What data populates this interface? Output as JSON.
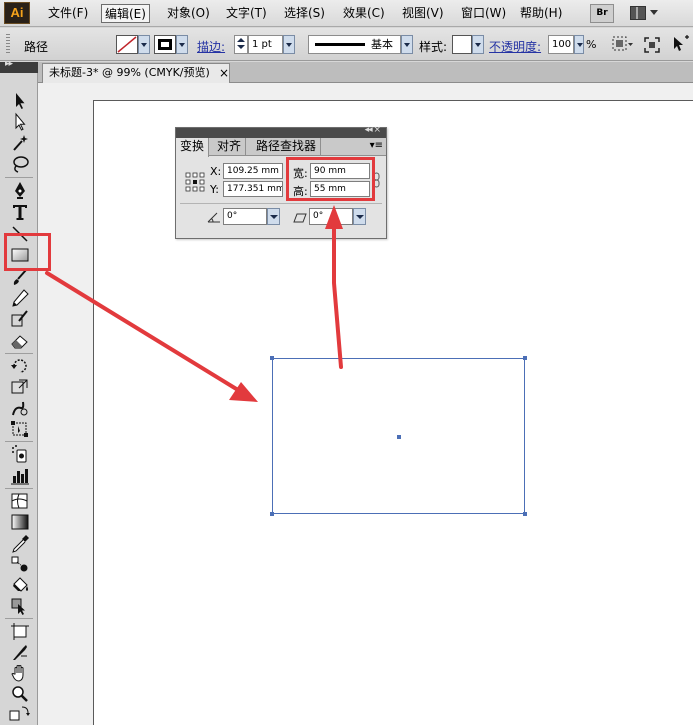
{
  "app": {
    "logo_text": "Ai"
  },
  "menu": {
    "items": [
      {
        "label": "文件(F)"
      },
      {
        "label": "编辑(E)"
      },
      {
        "label": "对象(O)"
      },
      {
        "label": "文字(T)"
      },
      {
        "label": "选择(S)"
      },
      {
        "label": "效果(C)"
      },
      {
        "label": "视图(V)"
      },
      {
        "label": "窗口(W)"
      },
      {
        "label": "帮助(H)"
      }
    ],
    "active_item": "编辑(E)",
    "bridge_button": "Br"
  },
  "control_bar": {
    "object_type": "路径",
    "stroke_label": "描边:",
    "stroke_weight": "1 pt",
    "brush_profile": "基本",
    "style_label": "样式:",
    "opacity_label": "不透明度:",
    "opacity_value": "100",
    "opacity_unit": "%"
  },
  "document_tab": {
    "title": "未标题-3* @ 99% (CMYK/预览)",
    "close_glyph": "×"
  },
  "tools": [
    {
      "name": "selection-tool"
    },
    {
      "name": "direct-selection-tool"
    },
    {
      "name": "magic-wand-tool"
    },
    {
      "name": "lasso-tool"
    },
    {
      "name": "pen-tool"
    },
    {
      "name": "type-tool"
    },
    {
      "name": "line-segment-tool"
    },
    {
      "name": "rectangle-tool",
      "selected": true
    },
    {
      "name": "paintbrush-tool"
    },
    {
      "name": "pencil-tool"
    },
    {
      "name": "blob-brush-tool"
    },
    {
      "name": "eraser-tool"
    },
    {
      "name": "rotate-tool"
    },
    {
      "name": "scale-tool"
    },
    {
      "name": "warp-tool"
    },
    {
      "name": "free-transform-tool"
    },
    {
      "name": "symbol-sprayer-tool"
    },
    {
      "name": "column-graph-tool"
    },
    {
      "name": "mesh-tool"
    },
    {
      "name": "gradient-tool"
    },
    {
      "name": "eyedropper-tool"
    },
    {
      "name": "blend-tool"
    },
    {
      "name": "live-paint-bucket-tool"
    },
    {
      "name": "live-paint-selection-tool"
    },
    {
      "name": "artboard-tool"
    },
    {
      "name": "slice-tool"
    },
    {
      "name": "hand-tool"
    },
    {
      "name": "zoom-tool"
    }
  ],
  "transform_panel": {
    "tabs": [
      {
        "label": "变换",
        "active": true
      },
      {
        "label": "对齐"
      },
      {
        "label": "路径查找器"
      }
    ],
    "x_label": "X:",
    "x_value": "109.25 mm",
    "y_label": "Y:",
    "y_value": "177.351 mm",
    "width_label": "宽:",
    "width_value": "90 mm",
    "height_label": "高:",
    "height_value": "55 mm",
    "rotate_value": "0°",
    "shear_value": "0°"
  },
  "colors": {
    "highlight": "#e23a3d",
    "selection": "#4c6fb6",
    "link": "#2533a4"
  }
}
